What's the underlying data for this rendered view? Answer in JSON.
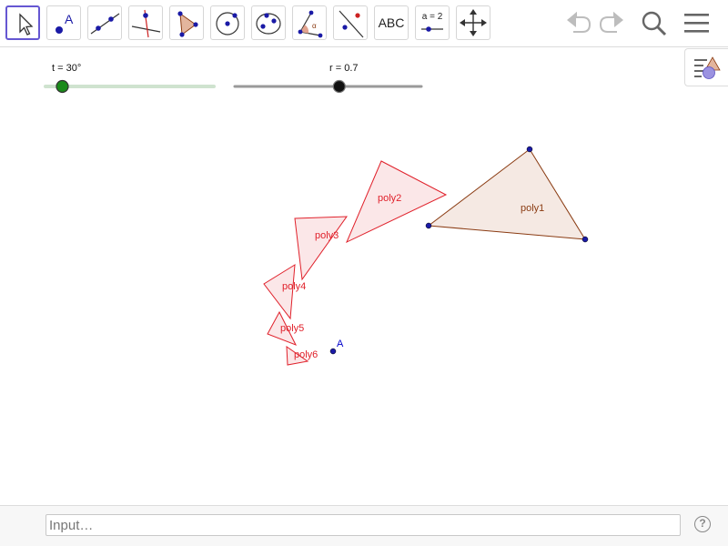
{
  "toolbar": {
    "tools": [
      {
        "name": "move-tool",
        "icon": "arrow-cursor-icon"
      },
      {
        "name": "point-tool",
        "icon": "point-icon",
        "label": "A"
      },
      {
        "name": "line-tool",
        "icon": "line-icon"
      },
      {
        "name": "perpendicular-line-tool",
        "icon": "perpendicular-line-icon"
      },
      {
        "name": "polygon-tool",
        "icon": "polygon-icon"
      },
      {
        "name": "circle-center-point-tool",
        "icon": "circle-icon"
      },
      {
        "name": "ellipse-tool",
        "icon": "ellipse-icon"
      },
      {
        "name": "angle-tool",
        "icon": "angle-icon",
        "label": "α"
      },
      {
        "name": "reflect-tool",
        "icon": "reflect-about-line-icon"
      },
      {
        "name": "text-tool",
        "icon": "text-icon",
        "label": "ABC"
      },
      {
        "name": "slider-tool",
        "icon": "slider-icon",
        "label": "a = 2"
      },
      {
        "name": "move-graphics-view-tool",
        "icon": "move-graphics-icon"
      }
    ],
    "right": [
      "undo-icon",
      "redo-icon",
      "search-icon",
      "menu-icon"
    ]
  },
  "sliders": {
    "t": {
      "label": "t = 30°",
      "value": 30,
      "fraction": 0.1,
      "color": "#1a8a1a",
      "track_color": "#cfe3cf"
    },
    "r": {
      "label": "r = 0.7",
      "value": 0.7,
      "fraction": 0.56,
      "color": "#111111",
      "track_color": "#9a9a9a"
    }
  },
  "polygons": [
    {
      "label": "poly1",
      "stroke": "#8a3b12",
      "fill": "#f5e9e3"
    },
    {
      "label": "poly2",
      "stroke": "#e0202a",
      "fill": "#fbe7e8"
    },
    {
      "label": "poly3",
      "stroke": "#e0202a",
      "fill": "#fbe7e8"
    },
    {
      "label": "poly4",
      "stroke": "#e0202a",
      "fill": "#fbe7e8"
    },
    {
      "label": "poly5",
      "stroke": "#e0202a",
      "fill": "#fbe7e8"
    },
    {
      "label": "poly6",
      "stroke": "#e0202a",
      "fill": "#fbe7e8"
    }
  ],
  "point_a": {
    "label": "A",
    "color": "#0000cc"
  },
  "input_bar": {
    "placeholder": "Input…",
    "help_label": "?"
  },
  "colors": {
    "accent": "#6557d2",
    "point": "#1a1aa6"
  }
}
